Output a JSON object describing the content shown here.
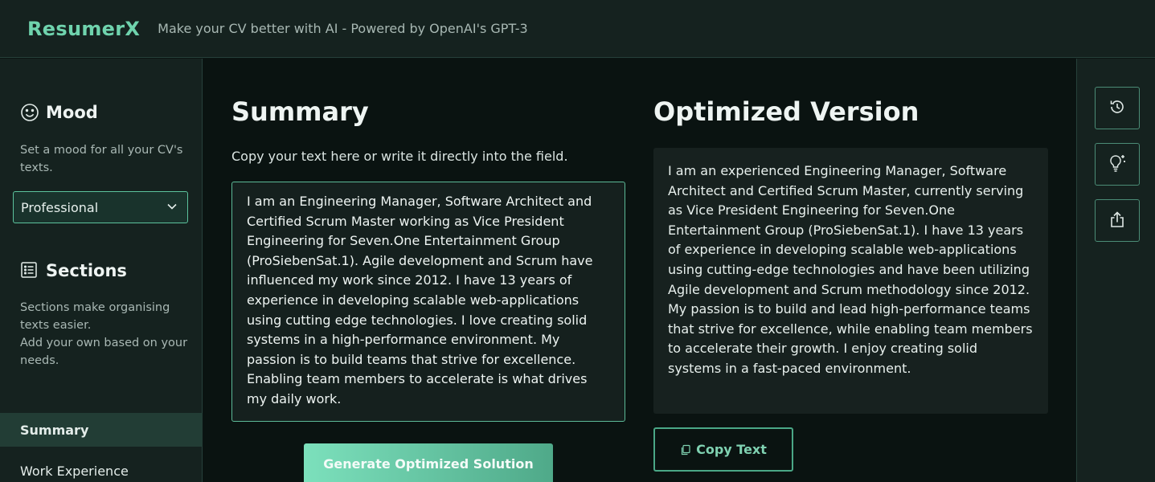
{
  "header": {
    "brand": "ResumerX",
    "tagline": "Make your CV better with AI - Powered by OpenAI's GPT-3"
  },
  "sidebar": {
    "mood": {
      "title": "Mood",
      "icon": "smiley-icon",
      "description": "Set a mood for all your CV's texts.",
      "selected": "Professional"
    },
    "sections": {
      "title": "Sections",
      "icon": "list-icon",
      "description_1": "Sections make organising texts easier.",
      "description_2": "Add your own based on your needs.",
      "items": [
        {
          "label": "Summary",
          "active": true
        },
        {
          "label": "Work Experience",
          "active": false
        }
      ]
    }
  },
  "main": {
    "summary": {
      "title": "Summary",
      "hint": "Copy your text here or write it directly into the field.",
      "text": "I am an Engineering Manager, Software Architect and Certified Scrum Master working as Vice President Engineering for Seven.One Entertainment Group (ProSiebenSat.1). Agile development and Scrum have influenced my work since 2012. I have 13 years of experience in developing scalable web-applications using cutting edge technologies. I love creating solid systems in a high-performance environment. My passion is to build teams that strive for excellence. Enabling team members to accelerate is what drives my daily work."
    },
    "generate_button": "Generate Optimized Solution",
    "optimized": {
      "title": "Optimized Version",
      "text": "I am an experienced Engineering Manager, Software Architect and Certified Scrum Master, currently serving as Vice President Engineering for Seven.One Entertainment Group (ProSiebenSat.1). I have 13 years of experience in developing scalable web-applications using cutting-edge technologies and have been utilizing Agile development and Scrum methodology since 2012. My passion is to build and lead high-performance teams that strive for excellence, while enabling team members to accelerate their growth. I enjoy creating solid systems in a fast-paced environment."
    },
    "copy_button": "Copy Text"
  },
  "rail": {
    "buttons": [
      "history-icon",
      "lightbulb-sparkle-icon",
      "share-icon"
    ]
  },
  "colors": {
    "accent": "#6fd3ad",
    "background": "#0a1311",
    "panel": "#15221f"
  }
}
